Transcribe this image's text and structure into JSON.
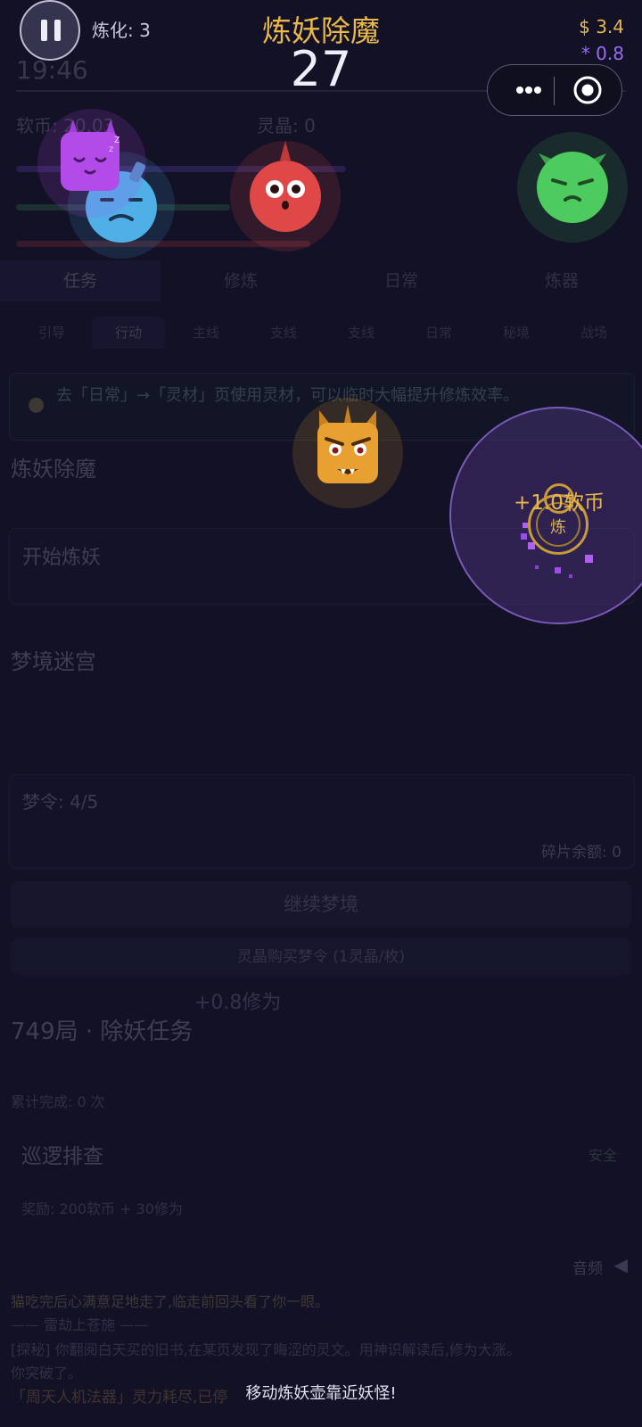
{
  "hud": {
    "refine_label": "炼化: 3",
    "title": "炼妖除魔",
    "countdown": "27",
    "money": "$ 3.4",
    "rate": "* 0.8"
  },
  "background": {
    "clock": "19:46",
    "soft_coin": "软币: 20.03",
    "spirit_crystal": "灵晶: 0",
    "tabs": [
      "任务",
      "修炼",
      "日常",
      "炼器"
    ],
    "subtabs": [
      "引导",
      "行动",
      "主线",
      "支线",
      "支线",
      "日常",
      "秘境",
      "战场"
    ],
    "tip_text": "去「日常」→「灵材」页使用灵材，可以临时大幅提升修炼效率。",
    "section1_title": "炼妖除魔",
    "start_title": "开始炼妖",
    "section2_title": "梦境迷宫",
    "dream_token": "梦令: 4/5",
    "fragment_balance": "碎片余额: 0",
    "continue_btn": "继续梦境",
    "buy_btn": "灵晶购买梦令 (1灵晶/枚)",
    "floating_gain": "+0.8修为",
    "section3_title": "749局 · 除妖任务",
    "total_done": "累计完成: 0 次",
    "patrol_title": "巡逻排查",
    "patrol_status": "安全",
    "patrol_reward": "奖励: 200软币 + 30修为",
    "sound_label": "音频",
    "log_lines": [
      "猫吃完后心满意足地走了,临走前回头看了你一眼。",
      "—— 雷劫上苍施 ——",
      "[探秘] 你翻阅白天买的旧书,在某页发现了晦涩的灵文。用神识解读后,修为大涨。",
      "你突破了。",
      "「周天人机法器」灵力耗尽,已停"
    ]
  },
  "effect": {
    "coin_gain": "+1.0软币",
    "cauldron_char": "炼"
  },
  "toast": "移动炼妖壶靠近妖怪!",
  "colors": {
    "gold": "#e8b84a",
    "purple": "#9a6cf0",
    "monster_purple": "#b24be8",
    "monster_blue": "#4fb0e8",
    "monster_red": "#e04848",
    "monster_green": "#4ecb5e",
    "monster_orange": "#e8a030"
  }
}
